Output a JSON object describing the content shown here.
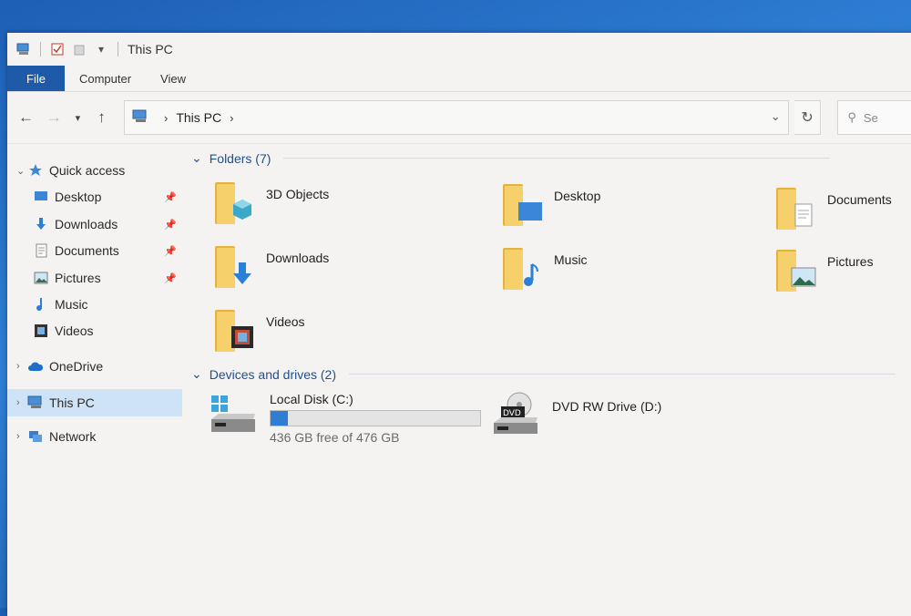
{
  "window": {
    "title": "This PC"
  },
  "ribbon": {
    "tabs": [
      "File",
      "Computer",
      "View"
    ]
  },
  "address": {
    "crumb": "This PC",
    "search_placeholder": "Se"
  },
  "sidebar": {
    "quick_access": "Quick access",
    "items": [
      "Desktop",
      "Downloads",
      "Documents",
      "Pictures",
      "Music",
      "Videos"
    ],
    "onedrive": "OneDrive",
    "this_pc": "This PC",
    "network": "Network"
  },
  "folders": {
    "header": "Folders (7)",
    "items": [
      {
        "label": "3D Objects",
        "icon": "3d-cube-icon"
      },
      {
        "label": "Desktop",
        "icon": "monitor-icon"
      },
      {
        "label": "Documents",
        "icon": "document-icon"
      },
      {
        "label": "Downloads",
        "icon": "download-arrow-icon"
      },
      {
        "label": "Music",
        "icon": "music-note-icon"
      },
      {
        "label": "Pictures",
        "icon": "landscape-icon"
      },
      {
        "label": "Videos",
        "icon": "film-icon"
      }
    ]
  },
  "drives": {
    "header": "Devices and drives (2)",
    "items": [
      {
        "name": "Local Disk (C:)",
        "free_text": "436 GB free of 476 GB",
        "used_fraction": 0.084
      },
      {
        "name": "DVD RW Drive (D:)"
      }
    ]
  },
  "colors": {
    "accent": "#1e5aa8",
    "folder": "#f6d06a",
    "progress": "#2e7fd3",
    "selected": "#cfe3f7"
  }
}
